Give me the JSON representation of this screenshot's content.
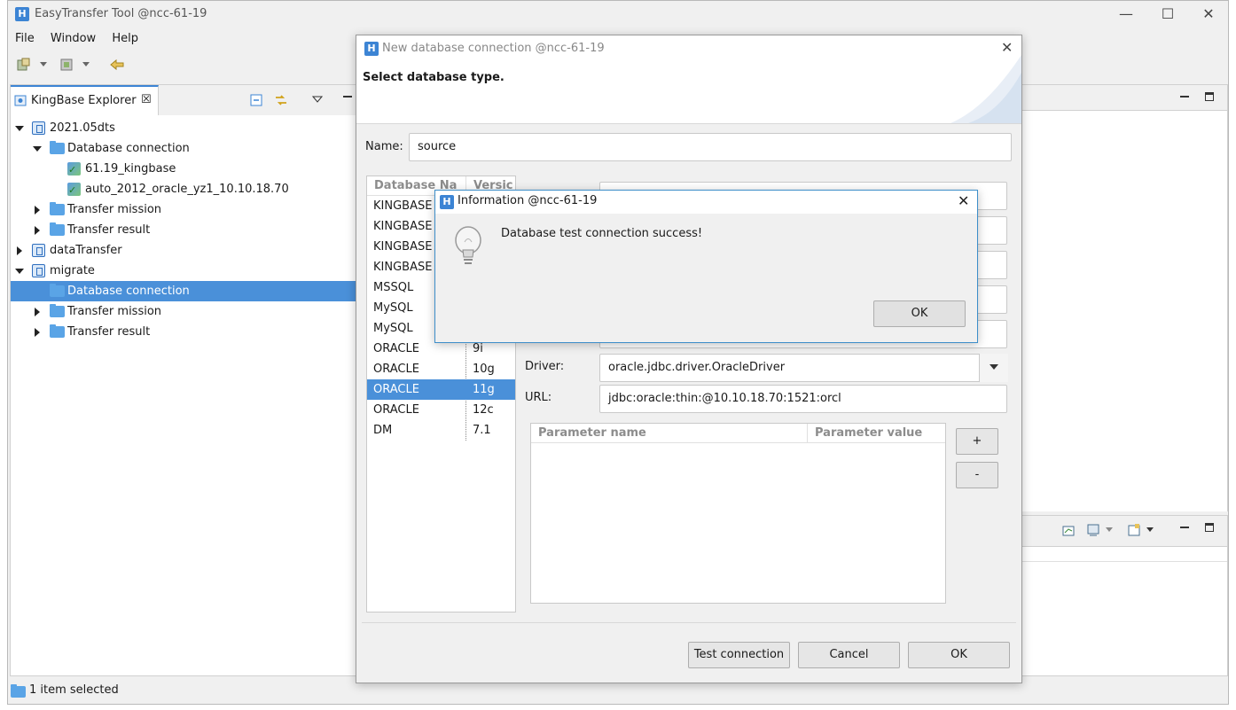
{
  "app": {
    "title": "EasyTransfer Tool @ncc-61-19",
    "menu": [
      "File",
      "Window",
      "Help"
    ],
    "controls": {
      "minimize": "—",
      "maximize": "☐",
      "close": "✕"
    }
  },
  "explorer": {
    "tab_label": "KingBase Explorer",
    "tree": [
      {
        "label": "2021.05dts"
      },
      {
        "label": "Database connection"
      },
      {
        "label": "61.19_kingbase"
      },
      {
        "label": "auto_2012_oracle_yz1_10.10.18.70"
      },
      {
        "label": "Transfer mission"
      },
      {
        "label": "Transfer result"
      },
      {
        "label": "dataTransfer"
      },
      {
        "label": "migrate"
      },
      {
        "label": "Database connection"
      },
      {
        "label": "Transfer mission"
      },
      {
        "label": "Transfer result"
      }
    ]
  },
  "status": {
    "text": "1 item selected"
  },
  "new_conn": {
    "title": "New database connection @ncc-61-19",
    "heading": "Select database type.",
    "name_label": "Name:",
    "name_value": "source",
    "list_headers": [
      "Database Na",
      "Versic"
    ],
    "db_list": [
      {
        "name": "KINGBASE",
        "ver": ""
      },
      {
        "name": "KINGBASE",
        "ver": ""
      },
      {
        "name": "KINGBASE",
        "ver": ""
      },
      {
        "name": "KINGBASE",
        "ver": ""
      },
      {
        "name": "MSSQL",
        "ver": ""
      },
      {
        "name": "MySQL",
        "ver": ""
      },
      {
        "name": "MySQL",
        "ver": ""
      },
      {
        "name": "ORACLE",
        "ver": "9i"
      },
      {
        "name": "ORACLE",
        "ver": "10g"
      },
      {
        "name": "ORACLE",
        "ver": "11g"
      },
      {
        "name": "ORACLE",
        "ver": "12c"
      },
      {
        "name": "DM",
        "ver": "7.1"
      }
    ],
    "driver_label": "Driver:",
    "driver_value": "oracle.jdbc.driver.OracleDriver",
    "url_label": "URL:",
    "url_value": "jdbc:oracle:thin:@10.10.18.70:1521:orcl",
    "param_headers": [
      "Parameter name",
      "Parameter value"
    ],
    "add_label": "+",
    "remove_label": "-",
    "test_label": "Test connection",
    "cancel_label": "Cancel",
    "ok_label": "OK"
  },
  "info": {
    "title": "Information @ncc-61-19",
    "message": "Database test connection success!",
    "ok_label": "OK"
  },
  "colors": {
    "selection": "#4a90d9",
    "accent": "#3c84d4"
  }
}
